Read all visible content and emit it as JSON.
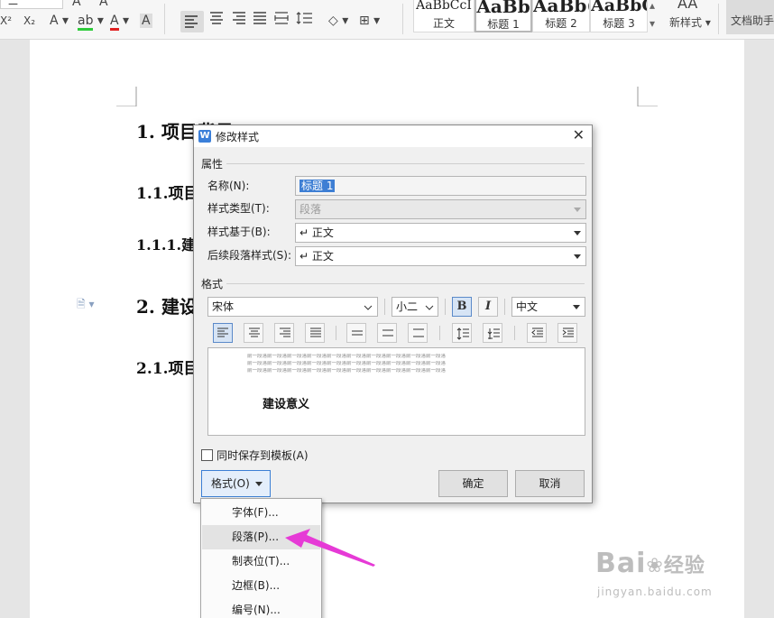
{
  "toolbar": {
    "font_size_value": "二",
    "style_gallery": [
      {
        "sample": "AaBbCcI",
        "label": "正文"
      },
      {
        "sample": "AaBb",
        "label": "标题 1"
      },
      {
        "sample": "AaBb(",
        "label": "标题 2"
      },
      {
        "sample": "AaBbC",
        "label": "标题 3"
      }
    ],
    "new_style_label": "新样式",
    "assistant_label": "文档助手"
  },
  "document": {
    "headings": [
      "1. 项目背景",
      "1.1.项目",
      "1.1.1.建",
      "2. 建设",
      "2.1.项目"
    ]
  },
  "dialog": {
    "title": "修改样式",
    "section_properties": "属性",
    "name_label": "名称(N):",
    "name_value": "标题 1",
    "style_type_label": "样式类型(T):",
    "style_type_value": "段落",
    "based_on_label": "样式基于(B):",
    "based_on_value": "正文",
    "next_style_label": "后续段落样式(S):",
    "next_style_value": "正文",
    "section_format": "格式",
    "font_value": "宋体",
    "size_value": "小二",
    "bold_label": "B",
    "italic_label": "I",
    "lang_value": "中文",
    "preview_prev_text": "前一段落前一段落前一段落前一段落前一段落前一段落前一段落前一段落前一段落前一段落",
    "preview_sample": "建设意义",
    "save_to_template": "同时保存到模板(A)",
    "format_button": "格式(O)",
    "ok_button": "确定",
    "cancel_button": "取消"
  },
  "format_menu": {
    "items": [
      "字体(F)...",
      "段落(P)...",
      "制表位(T)...",
      "边框(B)...",
      "编号(N)..."
    ]
  },
  "colors": {
    "accent": "#3e7fd4",
    "arrow": "#e63ad6"
  },
  "watermark": {
    "brand": "Bai",
    "brand_suffix": "经验",
    "url": "jingyan.baidu.com"
  }
}
